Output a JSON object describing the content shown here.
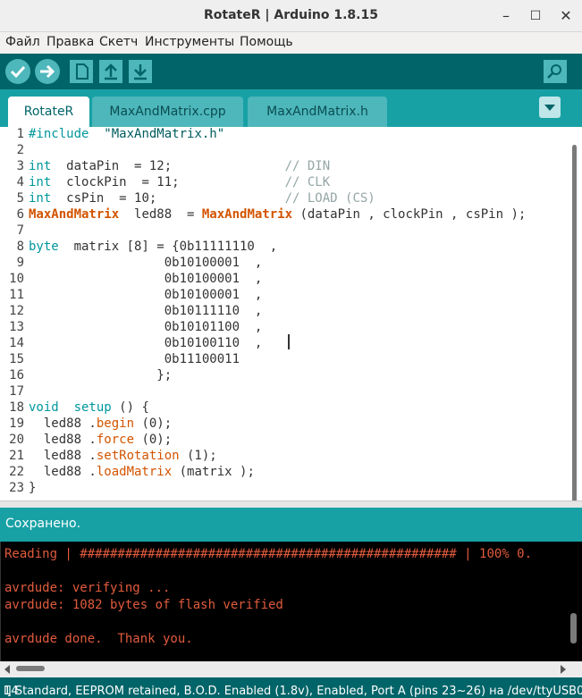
{
  "window": {
    "title": "RotateR | Arduino 1.8.15",
    "controls": {
      "minimize": "–",
      "maximize": "☐",
      "close": "✕"
    }
  },
  "menubar": {
    "items": [
      "Файл",
      "Правка",
      "Скетч",
      "Инструменты",
      "Помощь"
    ]
  },
  "toolbar": {
    "buttons": [
      "verify-icon",
      "upload-icon",
      "new-icon",
      "open-icon",
      "save-icon"
    ],
    "serial_monitor": "serial-monitor-icon"
  },
  "tabs": [
    {
      "label": "RotateR",
      "active": true
    },
    {
      "label": "MaxAndMatrix.cpp",
      "active": false
    },
    {
      "label": "MaxAndMatrix.h",
      "active": false
    }
  ],
  "editor": {
    "line_numbers": [
      "1",
      "2",
      "3",
      "4",
      "5",
      "6",
      "7",
      "8",
      "9",
      "10",
      "11",
      "12",
      "13",
      "14",
      "15",
      "16",
      "17",
      "18",
      "19",
      "20",
      "21",
      "22",
      "23"
    ],
    "code": {
      "l1_dir": "#include",
      "l1_str": "  \"MaxAndMatrix.h\"",
      "l3_type": "int",
      "l3_rest": "  dataPin  = 12;               ",
      "l3_cm": "// DIN",
      "l4_type": "int",
      "l4_rest": "  clockPin  = 11;              ",
      "l4_cm": "// CLK",
      "l5_type": "int",
      "l5_rest": "  csPin  = 10;                 ",
      "l5_cm": "// LOAD (CS)",
      "l6_cls1": "MaxAndMatrix",
      "l6_mid": "  led88  = ",
      "l6_cls2": "MaxAndMatrix",
      "l6_rest": " (dataPin , clockPin , csPin );",
      "l8_type": "byte",
      "l8_rest": "  matrix [8] = {0b11111110  ,",
      "l9": "                  0b10100001  ,",
      "l10": "                  0b10100001  ,",
      "l11": "                  0b10100001  ,",
      "l12": "                  0b10111110  ,",
      "l13": "                  0b10101100  ,",
      "l14": "                  0b10100110  ,",
      "l15": "                  0b11100011",
      "l16": "                 };",
      "l18_type": "void",
      "l18_fn": "  setup",
      "l18_rest": " () {",
      "l19_a": "  led88 .",
      "l19_fn": "begin",
      "l19_b": " (0);",
      "l20_a": "  led88 .",
      "l20_fn": "force",
      "l20_b": " (0);",
      "l21_a": "  led88 .",
      "l21_fn": "setRotation",
      "l21_b": " (1);",
      "l22_a": "  led88 .",
      "l22_fn": "loadMatrix",
      "l22_b": " (matrix );",
      "l23": "}"
    }
  },
  "status": {
    "text": "Сохранено."
  },
  "console": {
    "lines": [
      "Reading | ################################################## | 100% 0.",
      "",
      "avrdude: verifying ...",
      "avrdude: 1082 bytes of flash verified",
      "",
      "avrdude done.  Thank you."
    ]
  },
  "footer": {
    "line": "14",
    "board": "l] Standard, EEPROM retained, B.O.D. Enabled (1.8v), Enabled, Port A (pins 23~26) на /dev/ttyUSB0"
  },
  "colors": {
    "toolbar": "#006468",
    "tabbar": "#17a1a5",
    "keyword": "#00979c",
    "class": "#d35400",
    "console_text": "#e15b3d"
  }
}
